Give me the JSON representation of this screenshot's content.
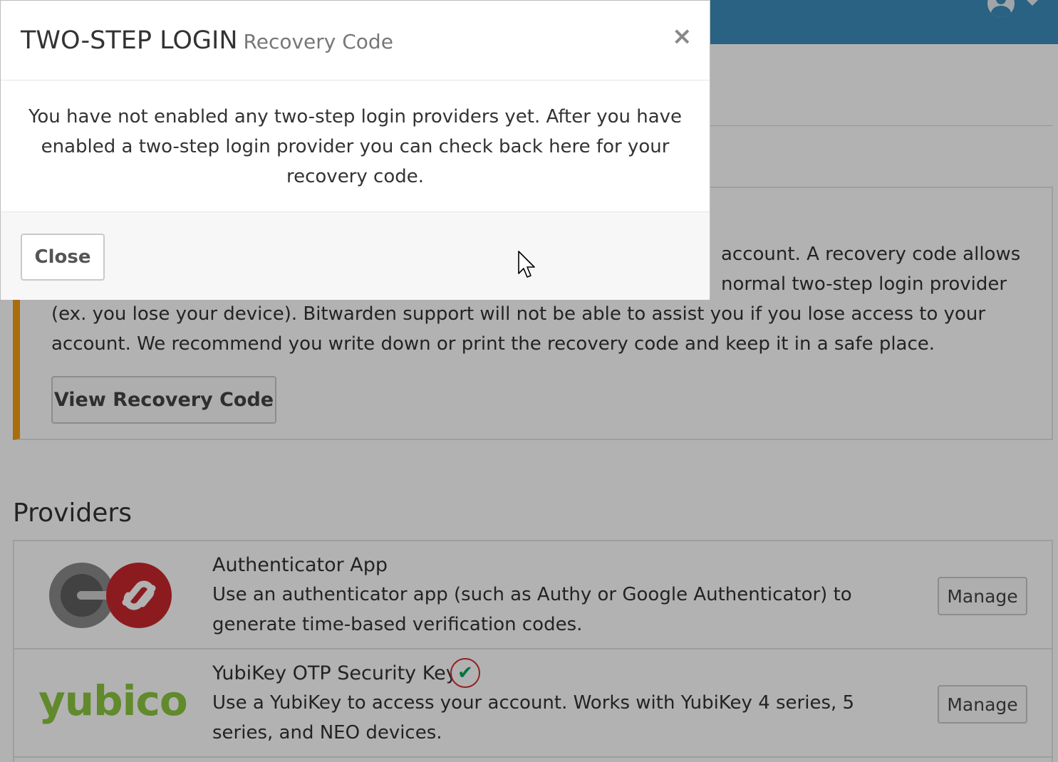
{
  "callout": {
    "text_line_1": "account. A recovery code allows",
    "text_line_2": "normal two-step login provider",
    "text_line_3": "(ex. you lose your device). Bitwarden support will not be able to assist you if you lose access to your account. We recommend you write down or print the recovery code and keep it in a safe place.",
    "button_label": "View Recovery Code"
  },
  "providers": {
    "heading": "Providers",
    "items": [
      {
        "name": "Authenticator App",
        "description": "Use an authenticator app (such as Authy or Google Authenticator) to generate time-based verification codes.",
        "manage_label": "Manage",
        "enabled": false
      },
      {
        "name": "YubiKey OTP Security Key",
        "description": "Use a YubiKey to access your account. Works with YubiKey 4 series, 5 series, and NEO devices.",
        "manage_label": "Manage",
        "logo_text": "yubico",
        "enabled": true,
        "check_glyph": "✔"
      }
    ]
  },
  "modal": {
    "title": "TWO-STEP LOGIN",
    "subtitle": "Recovery Code",
    "close_glyph": "×",
    "body": "You have not enabled any two-step login providers yet. After you have enabled a two-step login provider you can check back here for your recovery code.",
    "footer_button": "Close"
  },
  "colors": {
    "topbar": "#3c8dbc",
    "callout_accent": "#f39c12",
    "yubico_green": "#8cc63f",
    "check_green": "#00a65a",
    "highlight_red": "#d0312d"
  },
  "icons": [
    "user-avatar-icon",
    "caret-down-icon",
    "close-icon",
    "authenticator-logo-icon",
    "check-icon",
    "mouse-pointer-icon"
  ]
}
